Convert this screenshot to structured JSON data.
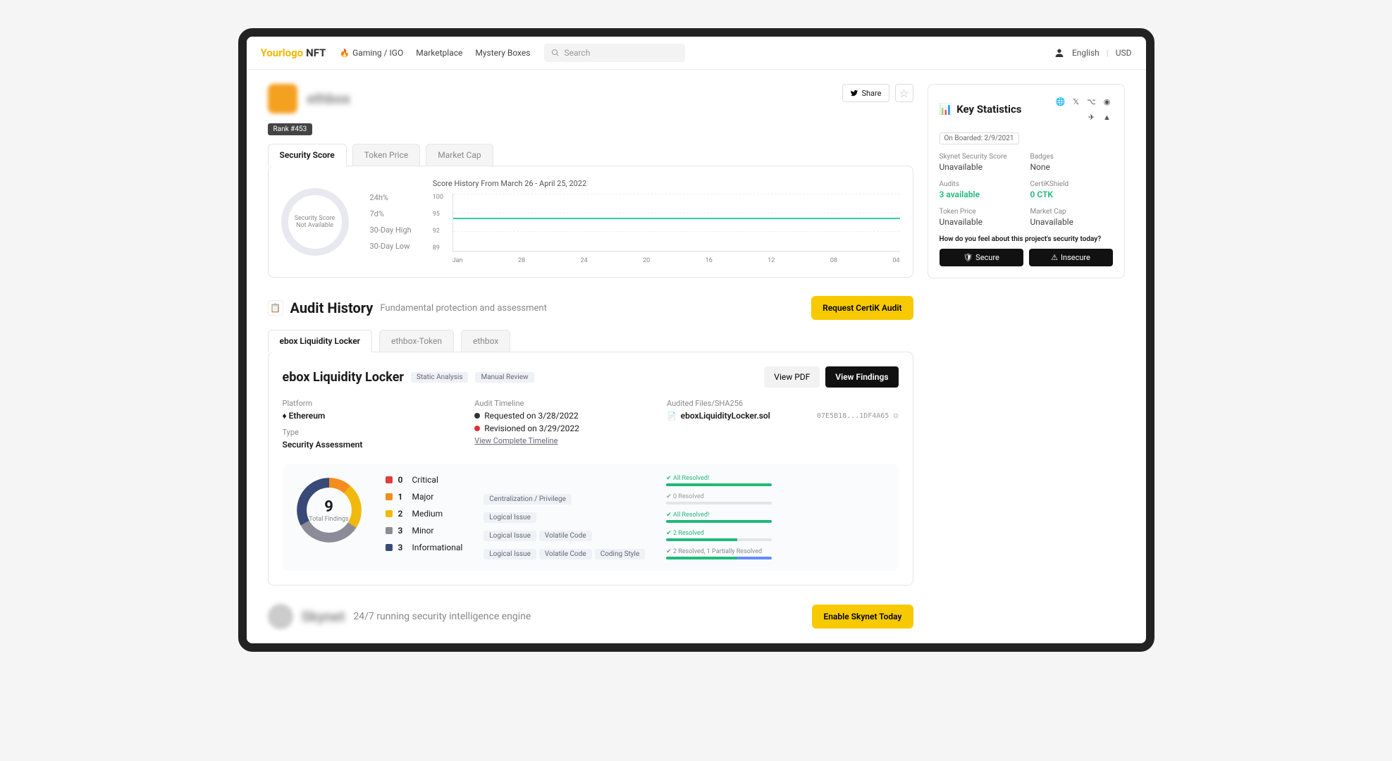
{
  "header": {
    "logo_y": "Yourlogo",
    "logo_n": "NFT",
    "nav": [
      "Gaming / IGO",
      "Marketplace",
      "Mystery Boxes"
    ],
    "search_placeholder": "Search",
    "lang": "English",
    "currency": "USD"
  },
  "project": {
    "name": "ethbox",
    "rank": "Rank #453",
    "share": "Share"
  },
  "score_tabs": [
    "Security Score",
    "Token Price",
    "Market Cap"
  ],
  "score_card": {
    "donut_line1": "Security Score",
    "donut_line2": "Not Available",
    "mini": [
      "24h%",
      "7d%",
      "30-Day High",
      "30-Day Low"
    ]
  },
  "chart_data": {
    "type": "line",
    "title": "Score History From March 26 - April 25, 2022",
    "y_ticks": [
      100,
      95,
      92,
      89
    ],
    "x_ticks": [
      "Jan",
      "28",
      "24",
      "20",
      "16",
      "12",
      "08",
      "04"
    ],
    "series": [
      {
        "name": "score",
        "value_constant": 95
      }
    ],
    "ylim": [
      89,
      100
    ]
  },
  "side": {
    "title": "Key Statistics",
    "onboarded": "On Boarded: 2/9/2021",
    "stats": [
      {
        "label": "Skynet Security Score",
        "val": "Unavailable"
      },
      {
        "label": "Badges",
        "val": "None"
      },
      {
        "label": "Audits",
        "val": "3 available",
        "green": true
      },
      {
        "label": "CertiKShield",
        "val": "0 CTK",
        "green": true
      },
      {
        "label": "Token Price",
        "val": "Unavailable"
      },
      {
        "label": "Market Cap",
        "val": "Unavailable"
      }
    ],
    "question": "How do you feel about this project's security today?",
    "secure": "Secure",
    "insecure": "Insecure"
  },
  "audit_section": {
    "title": "Audit History",
    "sub": "Fundamental protection and assessment",
    "cta": "Request CertiK Audit",
    "tabs": [
      "ebox Liquidity Locker",
      "ethbox-Token",
      "ethbox"
    ]
  },
  "audit": {
    "title": "ebox Liquidity Locker",
    "chips": [
      "Static Analysis",
      "Manual Review"
    ],
    "view_pdf": "View PDF",
    "view_findings": "View Findings",
    "platform_label": "Platform",
    "platform": "Ethereum",
    "type_label": "Type",
    "type": "Security Assessment",
    "timeline_label": "Audit Timeline",
    "timeline": [
      {
        "dot": "dark",
        "text": "Requested on 3/28/2022"
      },
      {
        "dot": "red",
        "text": "Revisioned on 3/29/2022"
      }
    ],
    "timeline_link": "View Complete Timeline",
    "files_label": "Audited Files/SHA256",
    "file": "eboxLiquidityLocker.sol",
    "hash": "07E5B18...1DF4A65"
  },
  "findings": {
    "total": "9",
    "total_label": "Total Findings",
    "rows": [
      {
        "cnt": "0",
        "label": "Critical",
        "color": "crit",
        "tags": [],
        "res": "All Resolved!",
        "res_class": "",
        "fill": 100
      },
      {
        "cnt": "1",
        "label": "Major",
        "color": "maj",
        "tags": [
          "Centralization / Privilege"
        ],
        "res": "0 Resolved",
        "res_class": "gray",
        "fill": 0
      },
      {
        "cnt": "2",
        "label": "Medium",
        "color": "med",
        "tags": [
          "Logical Issue"
        ],
        "res": "All Resolved!",
        "res_class": "",
        "fill": 100
      },
      {
        "cnt": "3",
        "label": "Minor",
        "color": "min",
        "tags": [
          "Logical Issue",
          "Volatile Code"
        ],
        "res": "2 Resolved",
        "res_class": "",
        "fill": 67
      },
      {
        "cnt": "3",
        "label": "Informational",
        "color": "info",
        "tags": [
          "Logical Issue",
          "Volatile Code",
          "Coding Style"
        ],
        "res": "2 Resolved, 1 Partially Resolved",
        "res_class": "mixed",
        "fill": 67,
        "partial": 33
      }
    ]
  },
  "skynet": {
    "name": "Skynet",
    "sub": "24/7 running security intelligence engine",
    "cta": "Enable Skynet Today"
  }
}
